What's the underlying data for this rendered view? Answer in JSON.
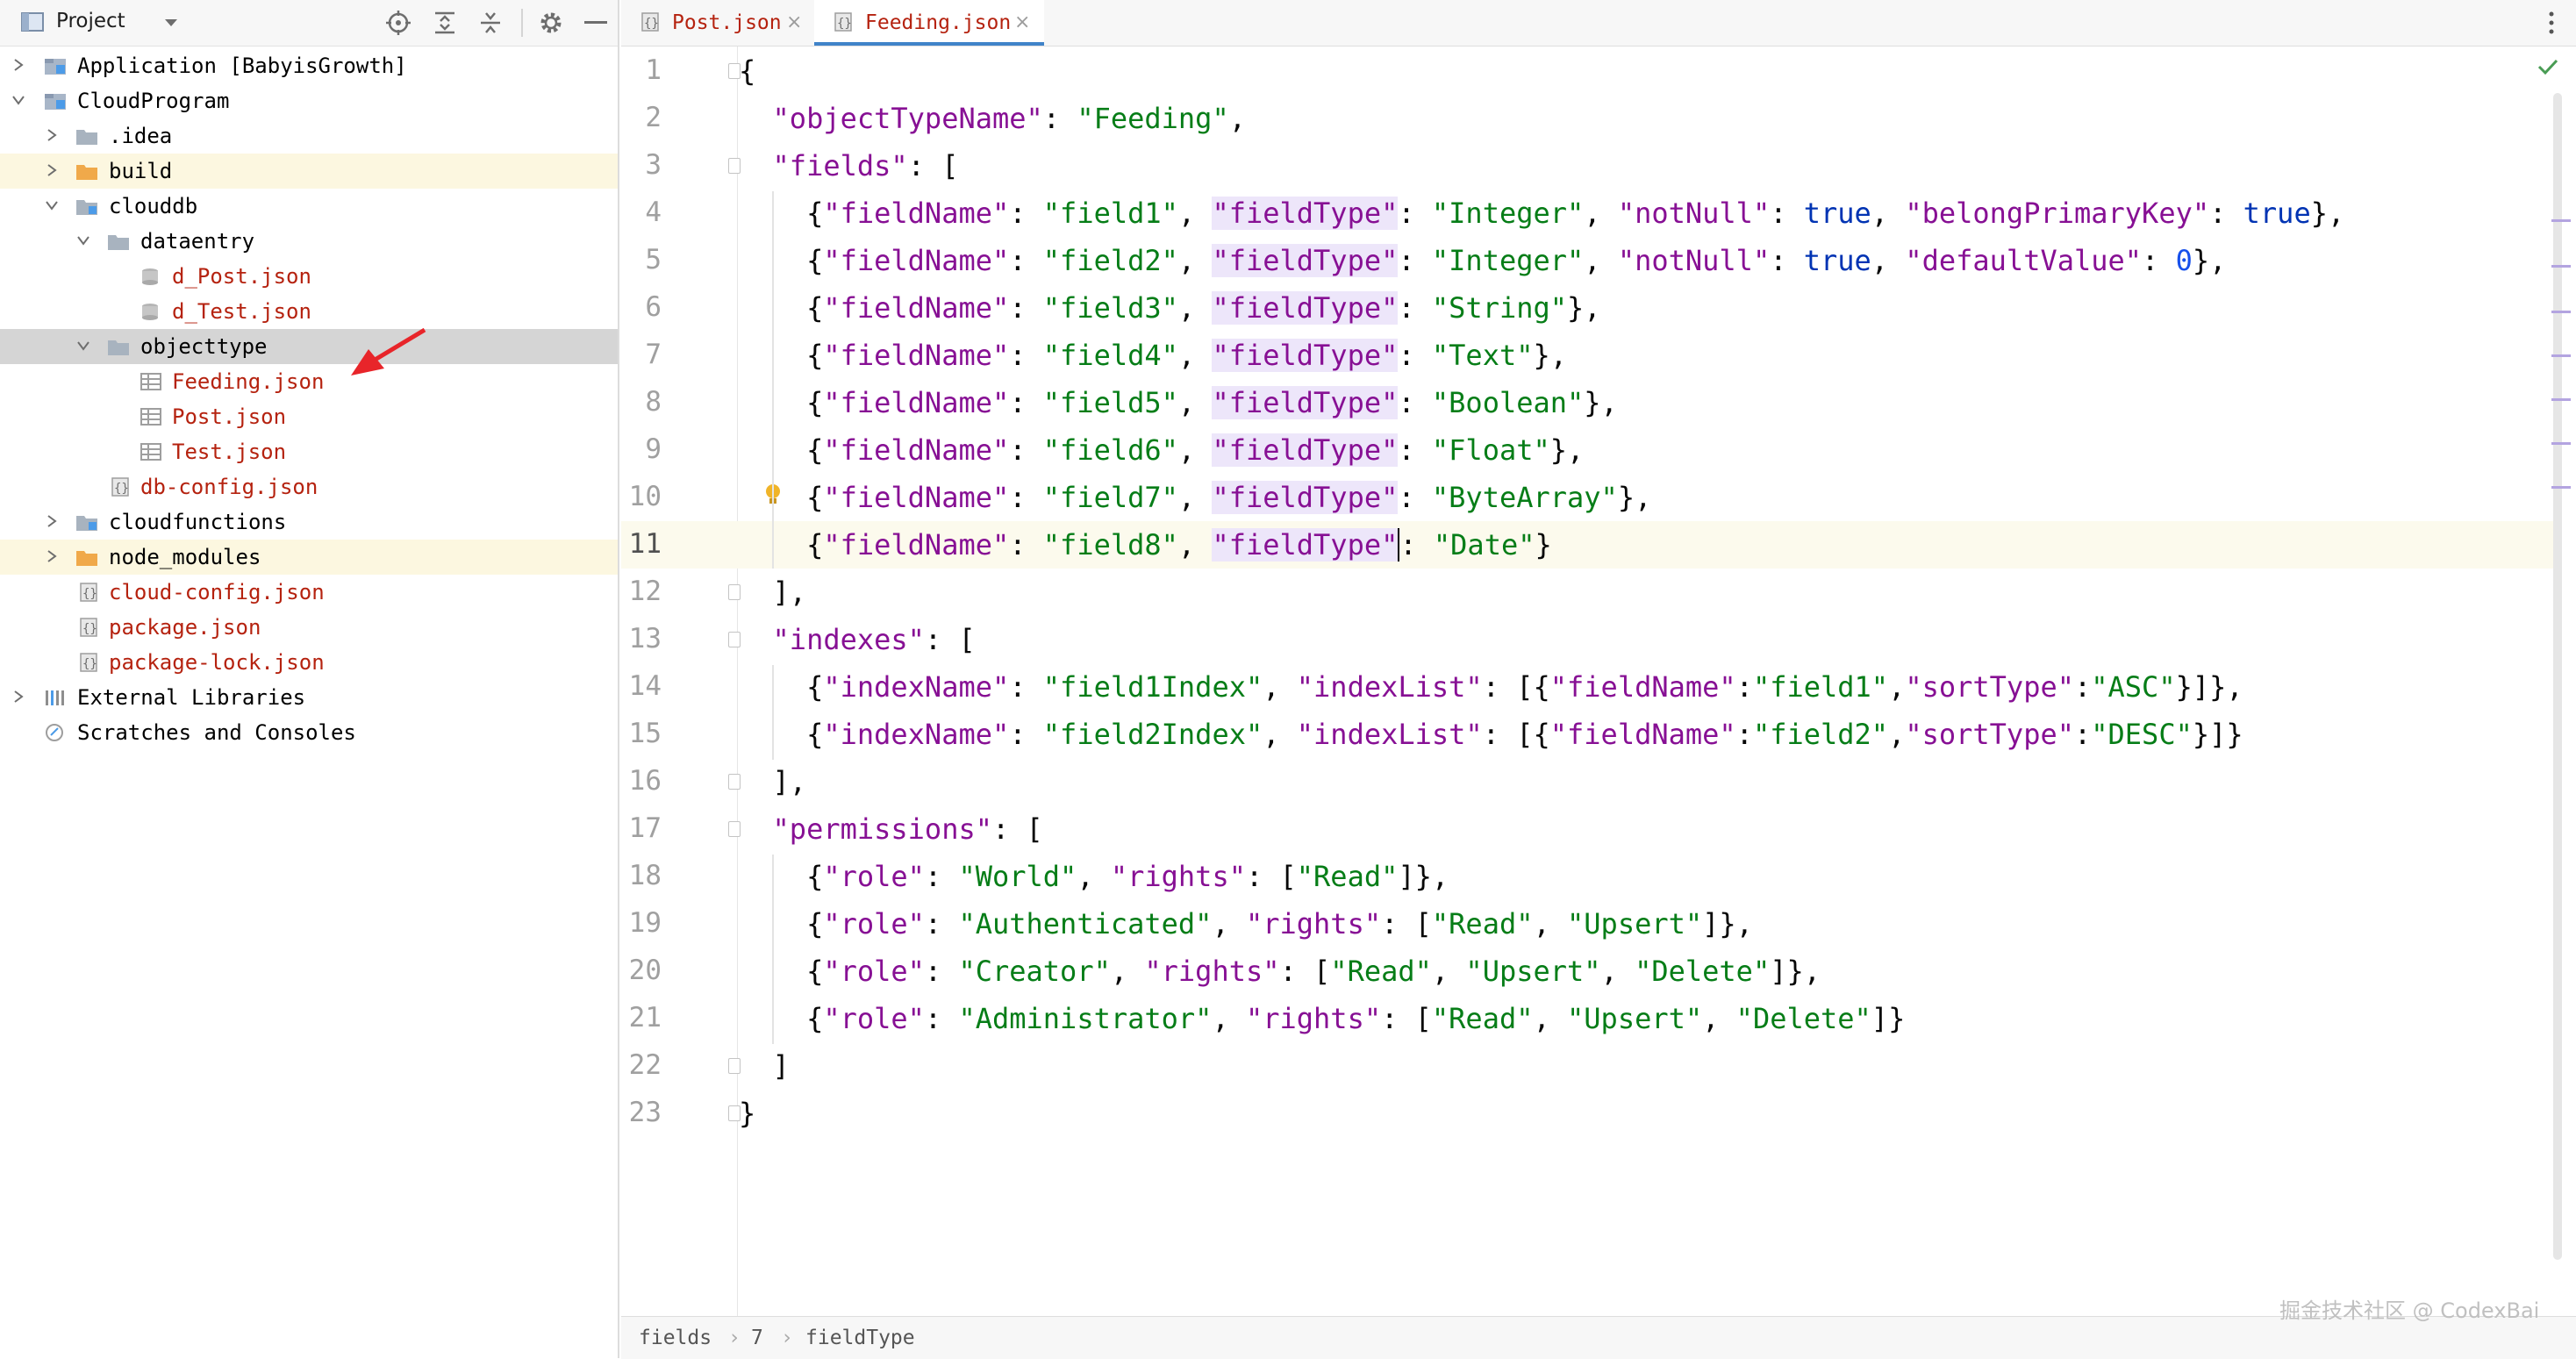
{
  "project_panel": {
    "title": "Project",
    "tree": [
      {
        "label": "Application [BabyisGrowth]",
        "icon": "app-module-icon",
        "expanded": false,
        "level": 0
      },
      {
        "label": "CloudProgram",
        "icon": "module-folder-icon",
        "expanded": true,
        "level": 0
      },
      {
        "label": ".idea",
        "icon": "folder-icon",
        "expanded": false,
        "level": 1
      },
      {
        "label": "build",
        "icon": "orange-folder-icon",
        "expanded": false,
        "level": 1
      },
      {
        "label": "clouddb",
        "icon": "folder-icon",
        "expanded": true,
        "level": 1
      },
      {
        "label": "dataentry",
        "icon": "folder-icon",
        "expanded": true,
        "level": 2
      },
      {
        "label": "d_Post.json",
        "icon": "database-icon",
        "level": 3
      },
      {
        "label": "d_Test.json",
        "icon": "database-icon",
        "level": 3
      },
      {
        "label": "objecttype",
        "icon": "folder-icon",
        "expanded": true,
        "level": 2,
        "selected": true
      },
      {
        "label": "Feeding.json",
        "icon": "table-icon",
        "level": 3
      },
      {
        "label": "Post.json",
        "icon": "table-icon",
        "level": 3
      },
      {
        "label": "Test.json",
        "icon": "table-icon",
        "level": 3
      },
      {
        "label": "db-config.json",
        "icon": "json-config-icon",
        "level": 2
      },
      {
        "label": "cloudfunctions",
        "icon": "folder-icon",
        "expanded": false,
        "level": 1
      },
      {
        "label": "node_modules",
        "icon": "orange-folder-icon",
        "expanded": false,
        "level": 1
      },
      {
        "label": "cloud-config.json",
        "icon": "json-config-icon",
        "level": 1
      },
      {
        "label": "package.json",
        "icon": "json-config-icon",
        "level": 1
      },
      {
        "label": "package-lock.json",
        "icon": "json-config-icon",
        "level": 1
      },
      {
        "label": "External Libraries",
        "icon": "libraries-icon",
        "expanded": false,
        "level": 0
      },
      {
        "label": "Scratches and Consoles",
        "icon": "scratches-icon",
        "level": 0
      }
    ]
  },
  "tabs": [
    {
      "label": "Post.json",
      "active": false
    },
    {
      "label": "Feeding.json",
      "active": true
    }
  ],
  "editor": {
    "current_line": 11,
    "line_numbers": [
      "1",
      "2",
      "3",
      "4",
      "5",
      "6",
      "7",
      "8",
      "9",
      "10",
      "11",
      "12",
      "13",
      "14",
      "15",
      "16",
      "17",
      "18",
      "19",
      "20",
      "21",
      "22",
      "23"
    ]
  },
  "breadcrumb": [
    "fields",
    "7",
    "fieldType"
  ],
  "watermark": "掘金技术社区 @ CodexBai",
  "colors": {
    "key": "#871094",
    "string": "#067d17",
    "number": "#1750eb",
    "keyword": "#0033b3",
    "accent": "#4083c9"
  }
}
